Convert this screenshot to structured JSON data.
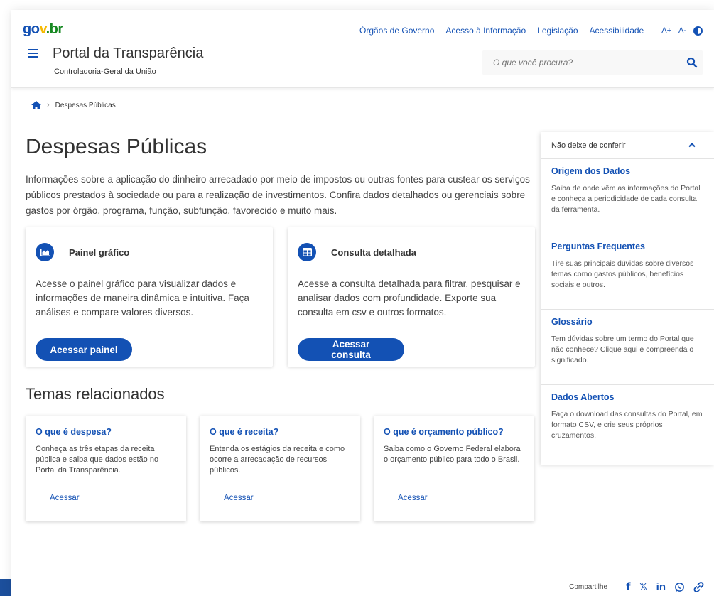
{
  "header": {
    "logo_part1": "go",
    "logo_part2": "v",
    "logo_part3": ".br",
    "top_links": [
      "Órgãos de Governo",
      "Acesso à Informação",
      "Legislação",
      "Acessibilidade"
    ],
    "font_increase": "A+",
    "font_decrease": "A-",
    "portal_title": "Portal da Transparência",
    "portal_subtitle": "Controladoria-Geral da União",
    "search_placeholder": "O que você procura?"
  },
  "breadcrumb": {
    "current": "Despesas Públicas"
  },
  "main": {
    "title": "Despesas Públicas",
    "intro": "Informações sobre a aplicação do dinheiro arrecadado por meio de impostos ou outras fontes para custear os serviços públicos prestados à sociedade ou para a realização de investimentos. Confira dados detalhados ou gerenciais sobre gastos por órgão, programa, função, subfunção, favorecido e muito mais.",
    "cards": [
      {
        "title": "Painel gráfico",
        "text": "Acesse o painel gráfico para visualizar dados e informações de maneira dinâmica e intuitiva. Faça análises e compare valores diversos.",
        "button": "Acessar painel"
      },
      {
        "title": "Consulta detalhada",
        "text": "Acesse a consulta detalhada para filtrar, pesquisar e analisar dados com profundidade. Exporte sua consulta em csv e outros formatos.",
        "button": "Acessar consulta"
      }
    ],
    "related_title": "Temas relacionados",
    "related": [
      {
        "title": "O que é despesa?",
        "text": "Conheça as três etapas da receita pública e saiba que dados estão no Portal da Transparência.",
        "link": "Acessar"
      },
      {
        "title": "O que é receita?",
        "text": "Entenda os estágios da receita e como ocorre a arrecadação de recursos públicos.",
        "link": "Acessar"
      },
      {
        "title": "O que é orçamento público?",
        "text": "Saiba como o Governo Federal elabora o orçamento público para todo o Brasil.",
        "link": "Acessar"
      }
    ]
  },
  "aside": {
    "heading": "Não deixe de conferir",
    "items": [
      {
        "title": "Origem dos Dados",
        "text": "Saiba de onde vêm as informações do Portal e conheça a periodicidade de cada consulta da ferramenta."
      },
      {
        "title": "Perguntas Frequentes",
        "text": "Tire suas principais dúvidas sobre diversos temas como gastos públicos, benefícios sociais e outros."
      },
      {
        "title": "Glossário",
        "text": "Tem dúvidas sobre um termo do Portal que não conhece? Clique aqui e compreenda o significado."
      },
      {
        "title": "Dados Abertos",
        "text": "Faça o download das consultas do Portal, em formato CSV, e crie seus próprios cruzamentos."
      }
    ]
  },
  "footer": {
    "share_label": "Compartilhe",
    "share_icons": [
      "facebook-icon",
      "x-icon",
      "linkedin-icon",
      "whatsapp-icon",
      "link-icon"
    ]
  },
  "colors": {
    "primary": "#1351b4",
    "logo_yellow": "#f6b900",
    "logo_green": "#168821",
    "text": "#333333"
  }
}
